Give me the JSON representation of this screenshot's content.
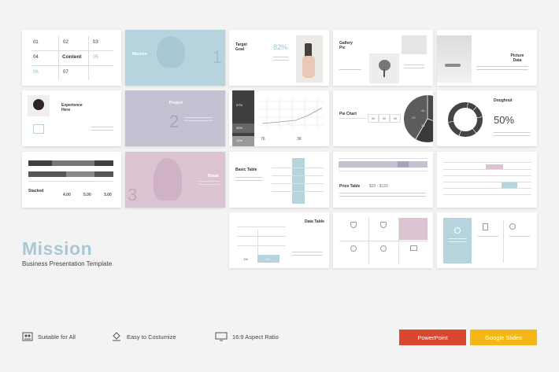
{
  "brand": {
    "title": "Mission",
    "subtitle": "Business Presentation Template"
  },
  "features": [
    {
      "label": "Suitable for All",
      "icon": "people-icon"
    },
    {
      "label": "Easy to Costumize",
      "icon": "brush-icon"
    },
    {
      "label": "16:9 Aspect Ratio",
      "icon": "monitor-icon"
    }
  ],
  "buttons": [
    {
      "label": "PowerPoint",
      "color": "#d9472f"
    },
    {
      "label": "Google Slides",
      "color": "#f3b817"
    }
  ],
  "slides": {
    "contents": {
      "nums": [
        "01",
        "02",
        "03",
        "04",
        "05",
        "06",
        "07"
      ],
      "center": "Content"
    },
    "mission_slide": {
      "label": "Mission",
      "num": "1"
    },
    "target_goal": {
      "label": "Target Goal",
      "percent": "82%"
    },
    "gallery": {
      "label": "Gallery Pic"
    },
    "picture_data": {
      "label": "Picture Data"
    },
    "experience": {
      "label": "Experience Here"
    },
    "project": {
      "label": "Project",
      "num": "2"
    },
    "bar_percent": {
      "values": [
        "57%",
        "30%",
        "15%"
      ],
      "foot_left": "76",
      "foot_right": "3K"
    },
    "pie_chart": {
      "label": "Pie Chart",
      "cells": [
        "00",
        "00",
        "00"
      ],
      "slices": [
        "44",
        "33",
        "23"
      ]
    },
    "doughnut": {
      "label": "Doughnut",
      "value": "50%"
    },
    "stacked": {
      "label": "Stacked",
      "values": [
        "4.00",
        "5.00",
        "3.00"
      ]
    },
    "break_slide": {
      "label": "Break",
      "num": "3"
    },
    "basic_table": {
      "label": "Basic Table"
    },
    "price_table": {
      "label": "Price Table",
      "range": "$20 - $120"
    },
    "data_table": {
      "label": "Data Table",
      "val1": "1%",
      "val2": "1%"
    }
  },
  "colors": {
    "blue": "#b6d4de",
    "purple": "#c6c0d3",
    "pink": "#dcc3d1",
    "dark": "#555555"
  }
}
